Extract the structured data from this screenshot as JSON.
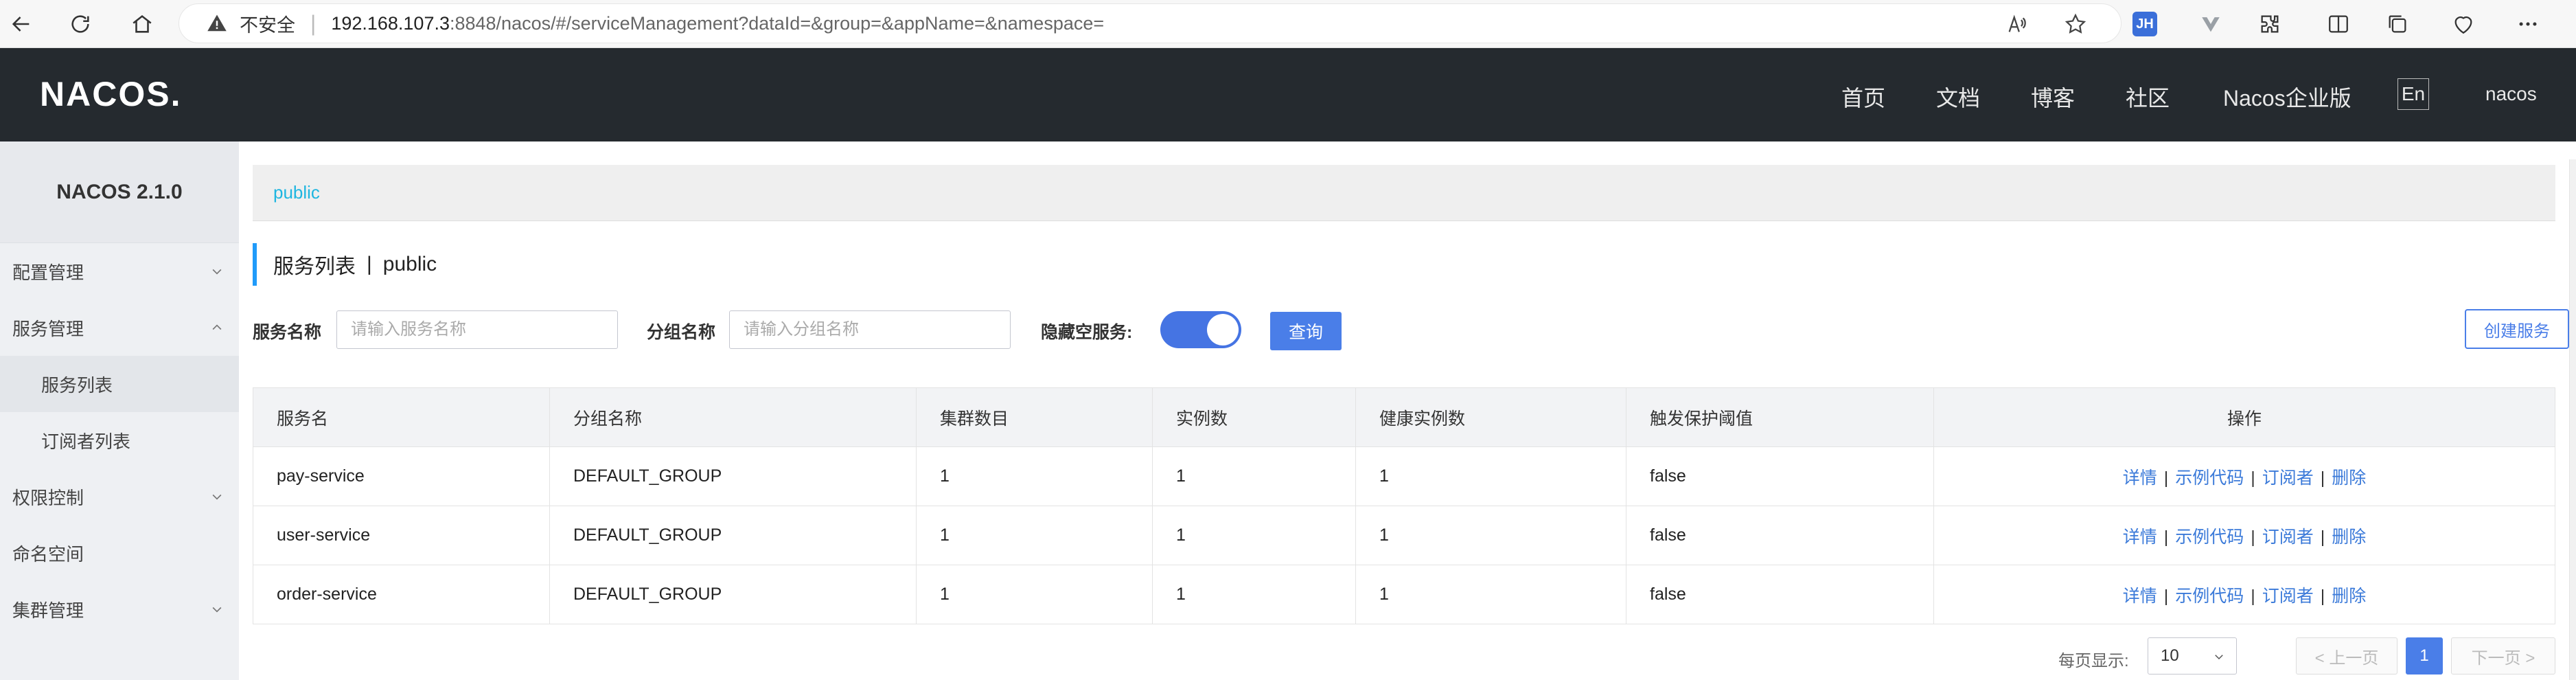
{
  "browser": {
    "insecure_label": "不安全",
    "url_host": "192.168.107.3",
    "url_path": ":8848/nacos/#/serviceManagement?dataId=&group=&appName=&namespace=",
    "ext_badge": "JH"
  },
  "header": {
    "logo": "NACOS.",
    "nav": [
      "首页",
      "文档",
      "博客",
      "社区",
      "Nacos企业版"
    ],
    "lang": "En",
    "user": "nacos"
  },
  "sidebar": {
    "version": "NACOS 2.1.0",
    "items": [
      {
        "label": "配置管理"
      },
      {
        "label": "服务管理"
      },
      {
        "label": "服务列表"
      },
      {
        "label": "订阅者列表"
      },
      {
        "label": "权限控制"
      },
      {
        "label": "命名空间"
      },
      {
        "label": "集群管理"
      }
    ]
  },
  "main": {
    "namespace_tab": "public",
    "title": "服务列表",
    "title_sep": "|",
    "title_ns": "public",
    "filters": {
      "service_label": "服务名称",
      "service_placeholder": "请输入服务名称",
      "group_label": "分组名称",
      "group_placeholder": "请输入分组名称",
      "hide_empty_label": "隐藏空服务:",
      "hide_empty_on": true,
      "query_button": "查询",
      "create_button": "创建服务"
    },
    "table": {
      "headers": [
        "服务名",
        "分组名称",
        "集群数目",
        "实例数",
        "健康实例数",
        "触发保护阈值",
        "操作"
      ],
      "rows": [
        [
          "pay-service",
          "DEFAULT_GROUP",
          "1",
          "1",
          "1",
          "false"
        ],
        [
          "user-service",
          "DEFAULT_GROUP",
          "1",
          "1",
          "1",
          "false"
        ],
        [
          "order-service",
          "DEFAULT_GROUP",
          "1",
          "1",
          "1",
          "false"
        ]
      ],
      "ops": [
        "详情",
        "示例代码",
        "订阅者",
        "删除"
      ],
      "ops_sep": "|"
    },
    "pagination": {
      "page_size_label": "每页显示:",
      "page_size": "10",
      "prev": "< 上一页",
      "current": "1",
      "next": "下一页 >"
    }
  }
}
